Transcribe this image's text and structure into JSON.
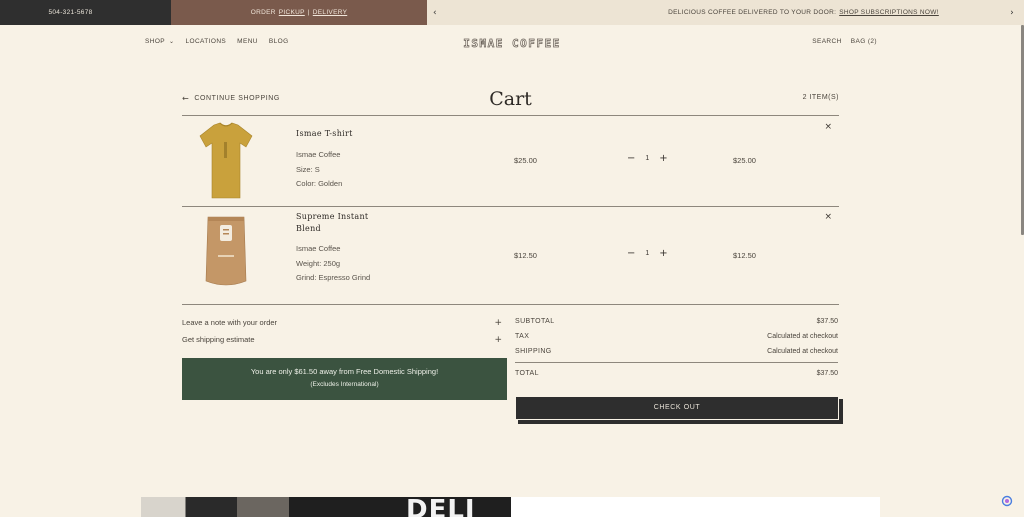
{
  "announcement": {
    "phone": "504-321-5678",
    "order_prefix": "ORDER",
    "pickup": "PICKUP",
    "separator": "|",
    "delivery": "DELIVERY",
    "promo_text": "DELICIOUS COFFEE DELIVERED TO YOUR DOOR:",
    "promo_link": "SHOP SUBSCRIPTIONS NOW!"
  },
  "nav": {
    "left": [
      "SHOP",
      "LOCATIONS",
      "MENU",
      "BLOG"
    ],
    "logo": "ISMAE COFFEE",
    "search": "SEARCH",
    "bag": "BAG (2)"
  },
  "cart": {
    "continue": "CONTINUE SHOPPING",
    "title": "Cart",
    "count": "2 ITEM(S)",
    "items": [
      {
        "name": "Ismae T-shirt",
        "vendor": "Ismae Coffee",
        "options": [
          "Size: S",
          "Color: Golden"
        ],
        "price": "$25.00",
        "qty": "1",
        "total": "$25.00"
      },
      {
        "name": "Supreme Instant Blend",
        "vendor": "Ismae Coffee",
        "options": [
          "Weight: 250g",
          "Grind: Espresso Grind"
        ],
        "price": "$12.50",
        "qty": "1",
        "total": "$12.50"
      }
    ]
  },
  "extras": {
    "note": "Leave a note with your order",
    "shipping_estimate": "Get shipping estimate",
    "free_ship_msg": "You are only $61.50 away from Free Domestic Shipping!",
    "free_ship_sub": "(Excludes International)"
  },
  "summary": {
    "subtotal_label": "SUBTOTAL",
    "subtotal": "$37.50",
    "tax_label": "TAX",
    "tax": "Calculated at checkout",
    "shipping_label": "SHIPPING",
    "shipping": "Calculated at checkout",
    "total_label": "TOTAL",
    "total": "$37.50",
    "checkout": "CHECK OUT"
  },
  "footer_image": {
    "sign_text": "DELI"
  },
  "colors": {
    "background": "#f8f2e6",
    "phone_bar": "#2f2f2f",
    "order_bar": "#7a5a4c",
    "shipping_banner": "#3b5340",
    "checkout_button": "#2e2e2e"
  }
}
